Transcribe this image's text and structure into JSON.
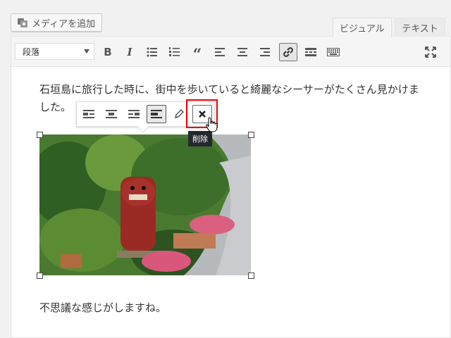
{
  "media_button": {
    "label": "メディアを追加",
    "icon": "media-icon"
  },
  "tabs": {
    "visual": "ビジュアル",
    "text": "テキスト"
  },
  "toolbar": {
    "format_select": "段落"
  },
  "content": {
    "paragraph1": "石垣島に旅行した時に、街中を歩いていると綺麗なシーサーがたくさん見かけました。",
    "paragraph2": "不思議な感じがしますね。"
  },
  "image_toolbar": {
    "remove_tooltip": "削除"
  },
  "colors": {
    "highlight": "#e00000",
    "tooltip_bg": "#23282d"
  }
}
